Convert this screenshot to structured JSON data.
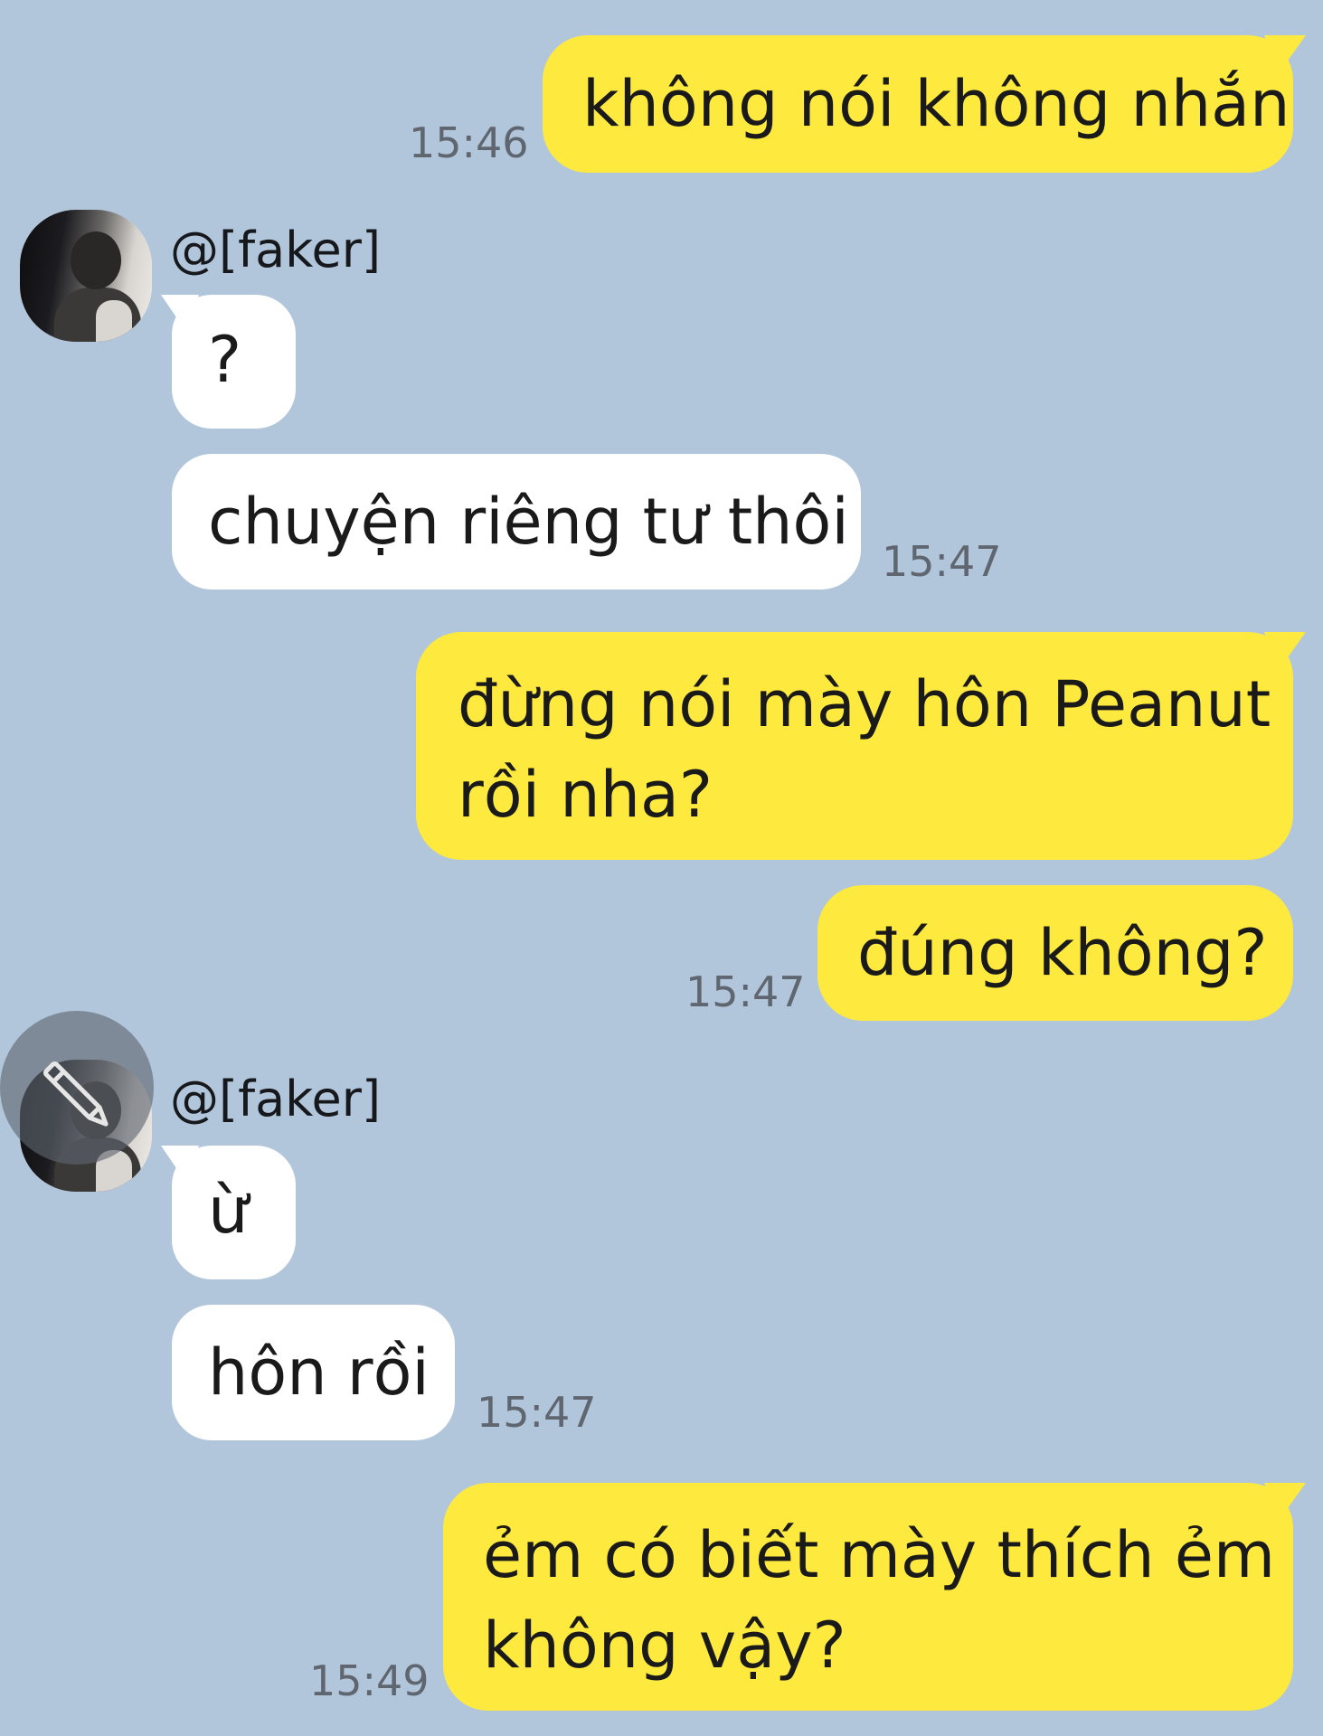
{
  "chat": {
    "contact_name": "@[faker]",
    "messages": [
      {
        "from": "me",
        "text": "không nói không nhắn",
        "time": "15:46"
      },
      {
        "from": "them",
        "text": "?"
      },
      {
        "from": "them",
        "text": "chuyện riêng tư thôi",
        "time": "15:47"
      },
      {
        "from": "me",
        "lines": [
          "đừng nói mày hôn Peanut",
          "rồi nha?"
        ]
      },
      {
        "from": "me",
        "text": "đúng không?",
        "time": "15:47"
      },
      {
        "from": "them",
        "text": "ừ"
      },
      {
        "from": "them",
        "text": "hôn rồi",
        "time": "15:47"
      },
      {
        "from": "me",
        "lines": [
          "ẻm có biết mày thích ẻm",
          "không vậy?"
        ],
        "time": "15:49"
      }
    ]
  },
  "colors": {
    "background": "#b1c6db",
    "my_bubble": "#fee93f",
    "their_bubble": "#ffffff",
    "timestamp": "#5f6670"
  },
  "icons": {
    "avatar": "contact-avatar-photo",
    "edit": "pencil-edit-icon"
  }
}
